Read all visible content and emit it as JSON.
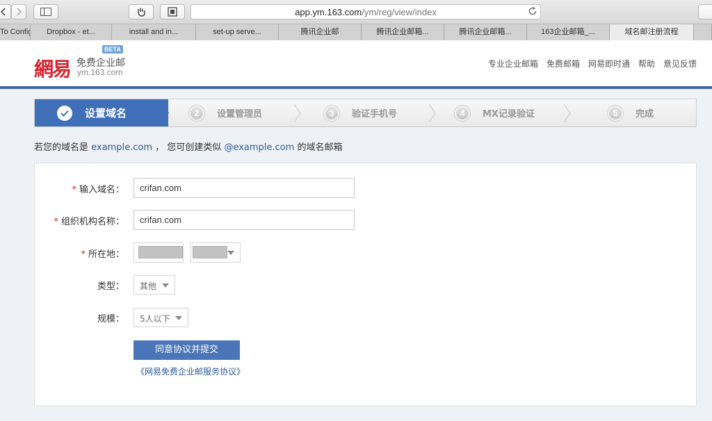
{
  "browser": {
    "url_host": "app.ym.163.com",
    "url_path": "/ym/reg/view/index",
    "tabs": [
      {
        "label": "To Config",
        "active": false
      },
      {
        "label": "Dropbox - et...",
        "active": false
      },
      {
        "label": "install and in...",
        "active": false
      },
      {
        "label": "set-up serve...",
        "active": false
      },
      {
        "label": "腾讯企业邮",
        "active": false
      },
      {
        "label": "腾讯企业邮箱...",
        "active": false
      },
      {
        "label": "腾讯企业邮箱...",
        "active": false
      },
      {
        "label": "163企业邮箱_...",
        "active": false
      },
      {
        "label": "域名邮注册流程",
        "active": true
      },
      {
        "label": "",
        "active": false
      }
    ]
  },
  "header": {
    "logo_mark": "網易",
    "logo_name": "免费企业邮",
    "logo_domain": "ym.163.com",
    "beta": "BETA",
    "nav": [
      "专业企业邮箱",
      "免费邮箱",
      "网易即时通",
      "帮助",
      "意见反馈"
    ]
  },
  "steps": [
    {
      "num": "",
      "label": "设置域名",
      "active": true
    },
    {
      "num": "2",
      "label": "设置管理员",
      "active": false
    },
    {
      "num": "3",
      "label": "验证手机号",
      "active": false
    },
    {
      "num": "4",
      "label": "MX记录验证",
      "active": false
    },
    {
      "num": "5",
      "label": "完成",
      "active": false
    }
  ],
  "notice": {
    "prefix": "若您的域名是",
    "domain": "example.com",
    "middle": "， 您可创建类似",
    "email": "@example.com",
    "suffix": "的域名邮箱"
  },
  "form": {
    "required_mark": "*",
    "domain_label": "输入域名：",
    "domain_value": "crifan.com",
    "org_label": "组织机构名称：",
    "org_value": "crifan.com",
    "location_label": "所在地：",
    "type_label": "类型：",
    "type_value": "其他",
    "scale_label": "规模：",
    "scale_value": "5人以下",
    "submit_label": "同意协议并提交",
    "agreement_link": "《网易免费企业邮服务协议》"
  },
  "colors": {
    "accent": "#3e6fb8",
    "required": "#d9232d",
    "logo": "#d7232f",
    "link": "#2d5b9b"
  }
}
